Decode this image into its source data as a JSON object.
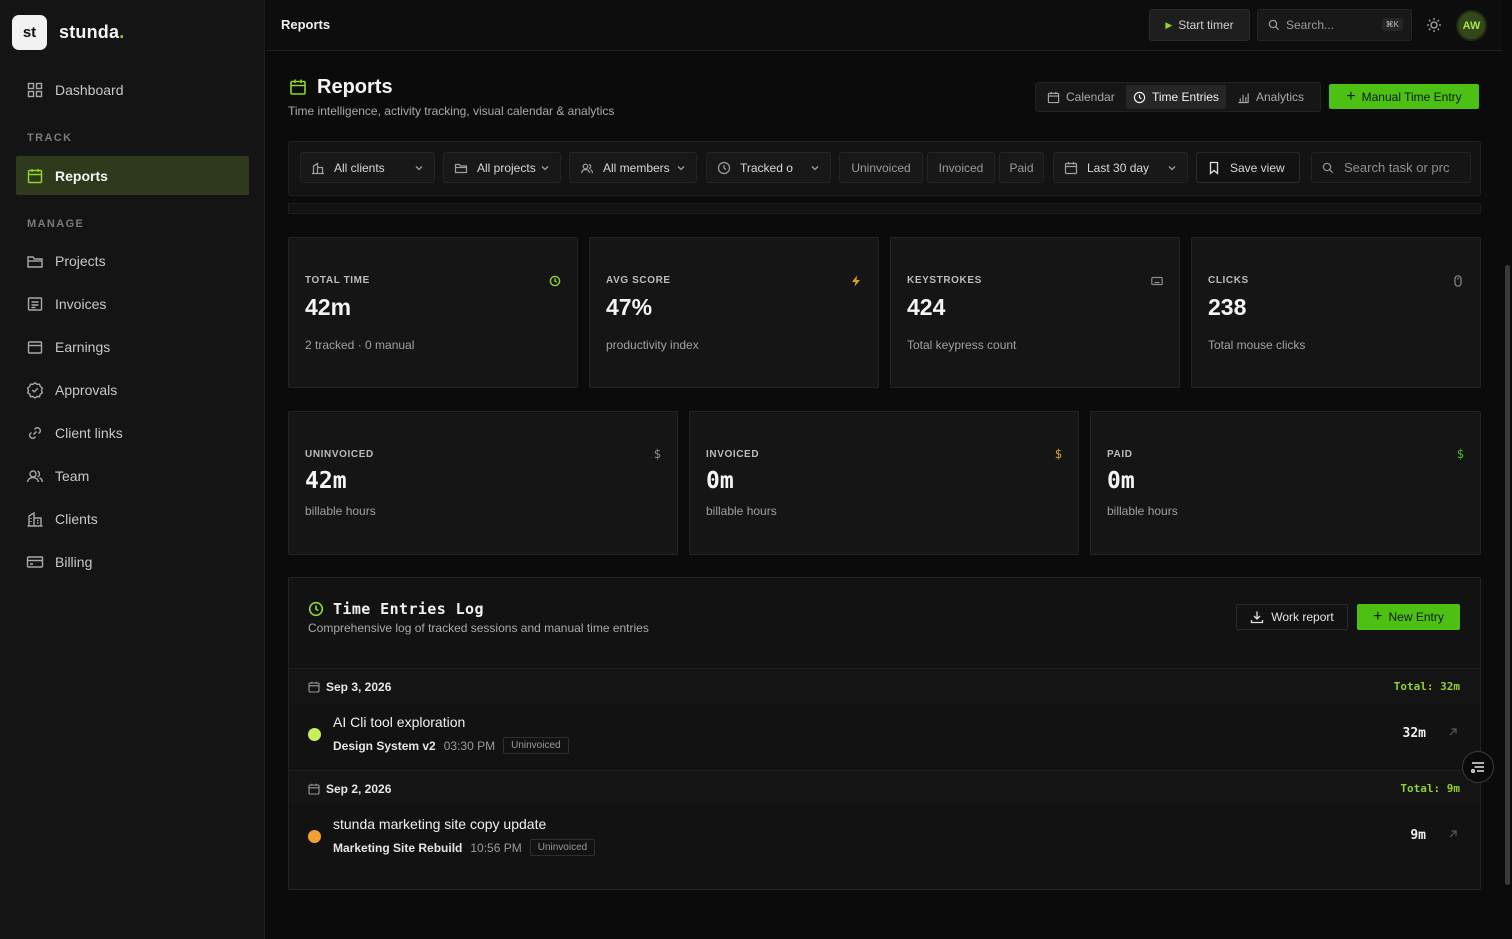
{
  "brand": {
    "logo_text": "st",
    "name": "stunda",
    "dot": "."
  },
  "sidebar": {
    "dashboard": {
      "label": "Dashboard",
      "icon": "grid-icon"
    },
    "section_track": "TRACK",
    "reports": {
      "label": "Reports",
      "icon": "calendar-icon",
      "active": true
    },
    "section_manage": "MANAGE",
    "items": [
      {
        "label": "Projects",
        "icon": "folder-icon"
      },
      {
        "label": "Invoices",
        "icon": "invoice-icon"
      },
      {
        "label": "Earnings",
        "icon": "wallet-icon"
      },
      {
        "label": "Approvals",
        "icon": "badge-check-icon"
      },
      {
        "label": "Client links",
        "icon": "link-icon"
      },
      {
        "label": "Team",
        "icon": "users-icon"
      },
      {
        "label": "Clients",
        "icon": "building-icon"
      },
      {
        "label": "Billing",
        "icon": "credit-card-icon"
      }
    ]
  },
  "topbar": {
    "title": "Reports",
    "start_timer": "Start timer",
    "search_placeholder": "Search...",
    "search_shortcut": "⌘K",
    "avatar_initials": "AW"
  },
  "header": {
    "title": "Reports",
    "subtitle": "Time intelligence, activity tracking, visual calendar & analytics",
    "tabs": [
      {
        "label": "Calendar",
        "icon": "calendar-icon",
        "active": false
      },
      {
        "label": "Time Entries",
        "icon": "clock-icon",
        "active": true
      },
      {
        "label": "Analytics",
        "icon": "bar-chart-icon",
        "active": false
      }
    ],
    "manual_entry": "Manual Time Entry"
  },
  "filters": {
    "clients": "All clients",
    "projects": "All projects",
    "members": "All members",
    "tracked": "Tracked o",
    "uninvoiced": "Uninvoiced",
    "invoiced": "Invoiced",
    "paid": "Paid",
    "date_range": "Last 30 day",
    "save_view": "Save view",
    "search_placeholder": "Search task or prc"
  },
  "stats": [
    {
      "label": "TOTAL TIME",
      "value": "42m",
      "sub": "2 tracked · 0 manual",
      "icon": "clock-icon"
    },
    {
      "label": "AVG SCORE",
      "value": "47%",
      "sub": "productivity index",
      "icon": "lightning-icon"
    },
    {
      "label": "KEYSTROKES",
      "value": "424",
      "sub": "Total keypress count",
      "icon": "keyboard-icon"
    },
    {
      "label": "CLICKS",
      "value": "238",
      "sub": "Total mouse clicks",
      "icon": "mouse-icon"
    }
  ],
  "billing_stats": [
    {
      "label": "UNINVOICED",
      "value": "42m",
      "sub": "billable hours",
      "icon": "dollar-icon"
    },
    {
      "label": "INVOICED",
      "value": "0m",
      "sub": "billable hours",
      "icon": "dollar-icon"
    },
    {
      "label": "PAID",
      "value": "0m",
      "sub": "billable hours",
      "icon": "dollar-icon"
    }
  ],
  "log": {
    "title": "Time Entries Log",
    "subtitle": "Comprehensive log of tracked sessions and manual time entries",
    "work_report": "Work report",
    "new_entry": "New Entry",
    "days": [
      {
        "date": "Sep 3, 2026",
        "total": "Total: 32m",
        "entries": [
          {
            "title": "AI Cli tool exploration",
            "project": "Design System v2",
            "time": "03:30 PM",
            "status": "Uninvoiced",
            "duration": "32m",
            "color": "#c6ef5a"
          }
        ]
      },
      {
        "date": "Sep 2, 2026",
        "total": "Total: 9m",
        "entries": [
          {
            "title": "stunda marketing site copy update",
            "project": "Marketing Site Rebuild",
            "time": "10:56 PM",
            "status": "Uninvoiced",
            "duration": "9m",
            "color": "#f0a230"
          }
        ]
      }
    ]
  },
  "colors": {
    "accent": "#4cc114",
    "accent_text": "#8ed42c",
    "sidebar_active": "#2f3a1c"
  }
}
